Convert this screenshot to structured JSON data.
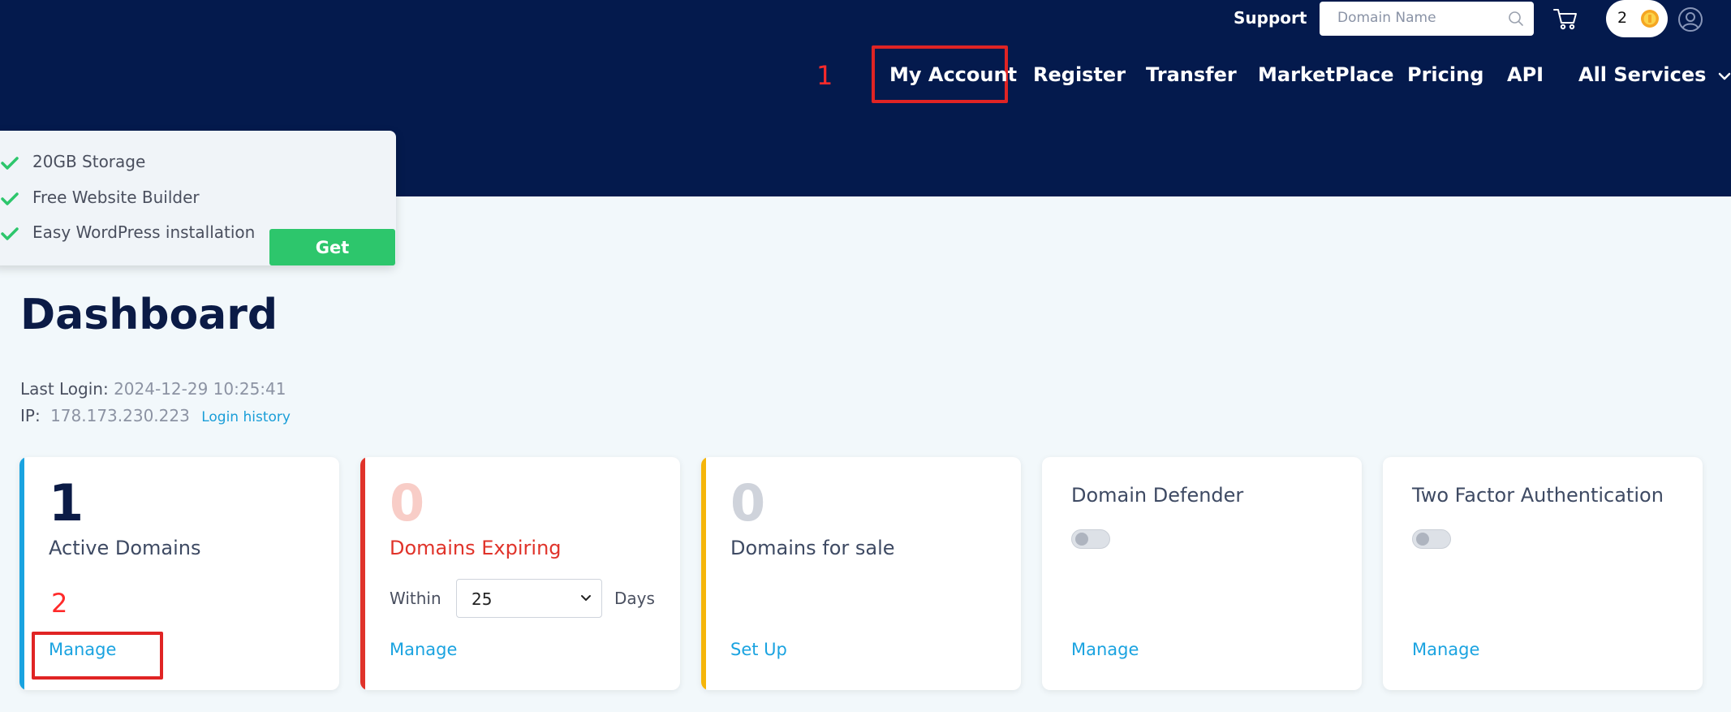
{
  "header": {
    "support_label": "Support",
    "search_placeholder": "Domain Name",
    "coin_count": "2",
    "nav": [
      "My Account",
      "Register",
      "Transfer",
      "MarketPlace",
      "Pricing",
      "API",
      "All Services"
    ]
  },
  "annotations": {
    "one": "1",
    "two": "2"
  },
  "promo": {
    "items": [
      "20GB Storage",
      "Free Website Builder",
      "Easy WordPress installation"
    ],
    "button": "Get"
  },
  "dashboard": {
    "title": "Dashboard",
    "last_login_label": "Last Login:",
    "last_login_value": "2024-12-29 10:25:41",
    "ip_label": "IP:",
    "ip_value": "178.173.230.223",
    "login_history": "Login history"
  },
  "cards": {
    "active": {
      "count": "1",
      "label": "Active Domains",
      "link": "Manage"
    },
    "expiring": {
      "count": "0",
      "label": "Domains Expiring",
      "within": "Within",
      "selected": "25",
      "days": "Days",
      "link": "Manage"
    },
    "for_sale": {
      "count": "0",
      "label": "Domains for sale",
      "link": "Set Up"
    },
    "defender": {
      "title": "Domain Defender",
      "link": "Manage"
    },
    "two_factor": {
      "title": "Two Factor Authentication",
      "link": "Manage"
    }
  },
  "colors": {
    "header_bg": "#041a4d",
    "accent_blue": "#1aa3e0",
    "accent_red": "#e0332a",
    "accent_yellow": "#f5b50a",
    "get_green": "#2dc66c"
  }
}
